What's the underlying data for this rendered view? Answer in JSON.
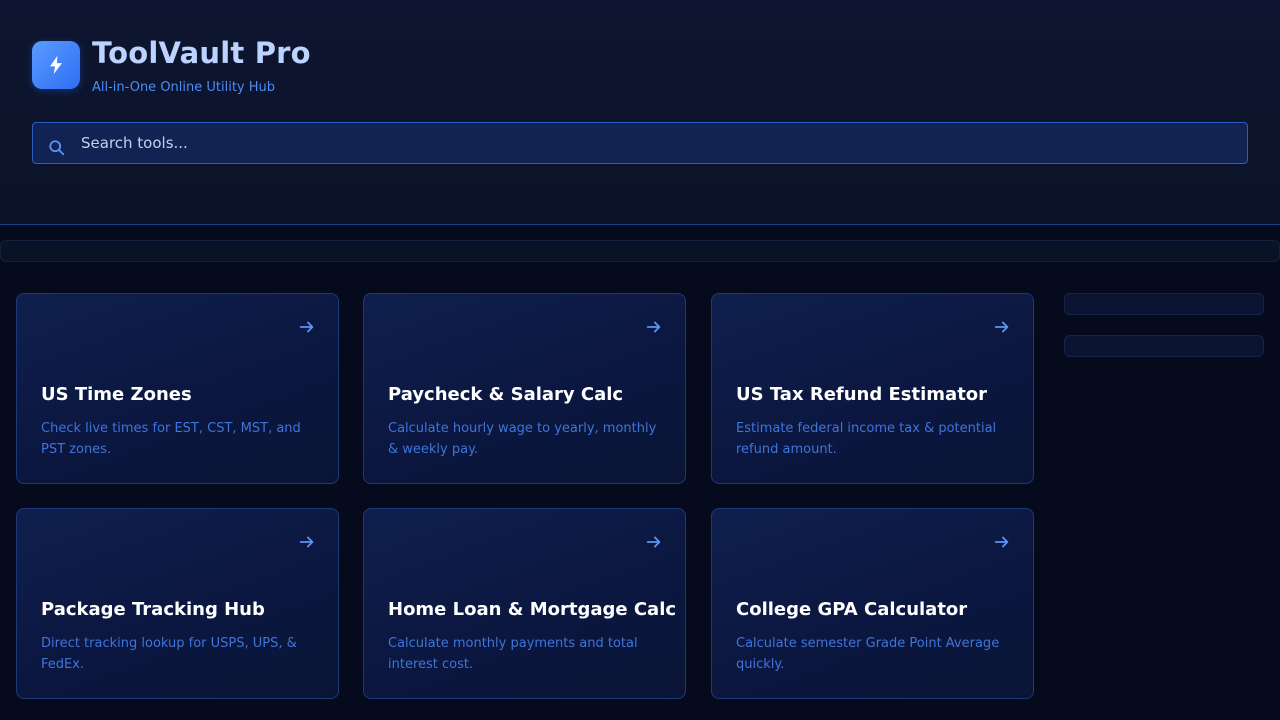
{
  "app": {
    "title": "ToolVault Pro",
    "subtitle": "All-in-One Online Utility Hub",
    "logo_icon": "lightning-bolt-icon"
  },
  "search": {
    "placeholder": "Search tools...",
    "value": ""
  },
  "colors": {
    "accent": "#4d8cf5",
    "background": "#050a1c",
    "card_border": "#1f3878"
  },
  "tools": [
    {
      "title": "US Time Zones",
      "description": "Check live times for EST, CST, MST, and PST zones."
    },
    {
      "title": "Paycheck & Salary Calc",
      "description": "Calculate hourly wage to yearly, monthly & weekly pay."
    },
    {
      "title": "US Tax Refund Estimator",
      "description": "Estimate federal income tax & potential refund amount."
    },
    {
      "title": "Package Tracking Hub",
      "description": "Direct tracking lookup for USPS, UPS, & FedEx."
    },
    {
      "title": "Home Loan & Mortgage Calc",
      "description": "Calculate monthly payments and total interest cost."
    },
    {
      "title": "College GPA Calculator",
      "description": "Calculate semester Grade Point Average quickly."
    }
  ]
}
